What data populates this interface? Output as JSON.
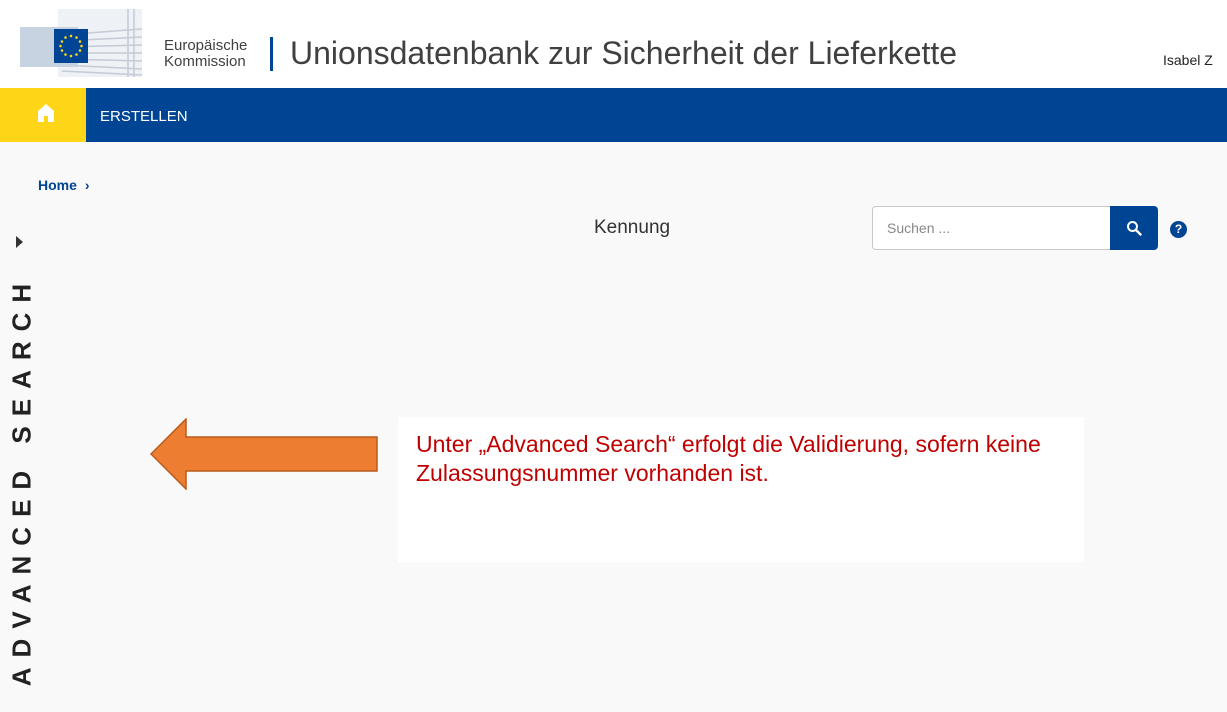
{
  "header": {
    "logo_line1": "Europäische",
    "logo_line2": "Kommission",
    "title": "Unionsdatenbank zur Sicherheit der Lieferkette",
    "user": "Isabel Z"
  },
  "nav": {
    "home_icon": "home-icon",
    "items": [
      {
        "label": "ERSTELLEN"
      }
    ]
  },
  "breadcrumb": {
    "home": "Home",
    "separator": "›"
  },
  "sidebar": {
    "label": "ADVANCED SEARCH",
    "toggle_icon": "caret-right-icon"
  },
  "search": {
    "label": "Kennung",
    "placeholder": "Suchen ...",
    "value": "",
    "button_icon": "search-icon",
    "help_icon": "?"
  },
  "annotation": {
    "text": "Unter „Advanced Search“ erfolgt die Validierung, sofern keine Zulassungsnummer vorhanden ist."
  },
  "colors": {
    "primary": "#004494",
    "accent_yellow": "#ffd617",
    "annotation_text": "#c00000",
    "arrow": "#ed7d31"
  }
}
